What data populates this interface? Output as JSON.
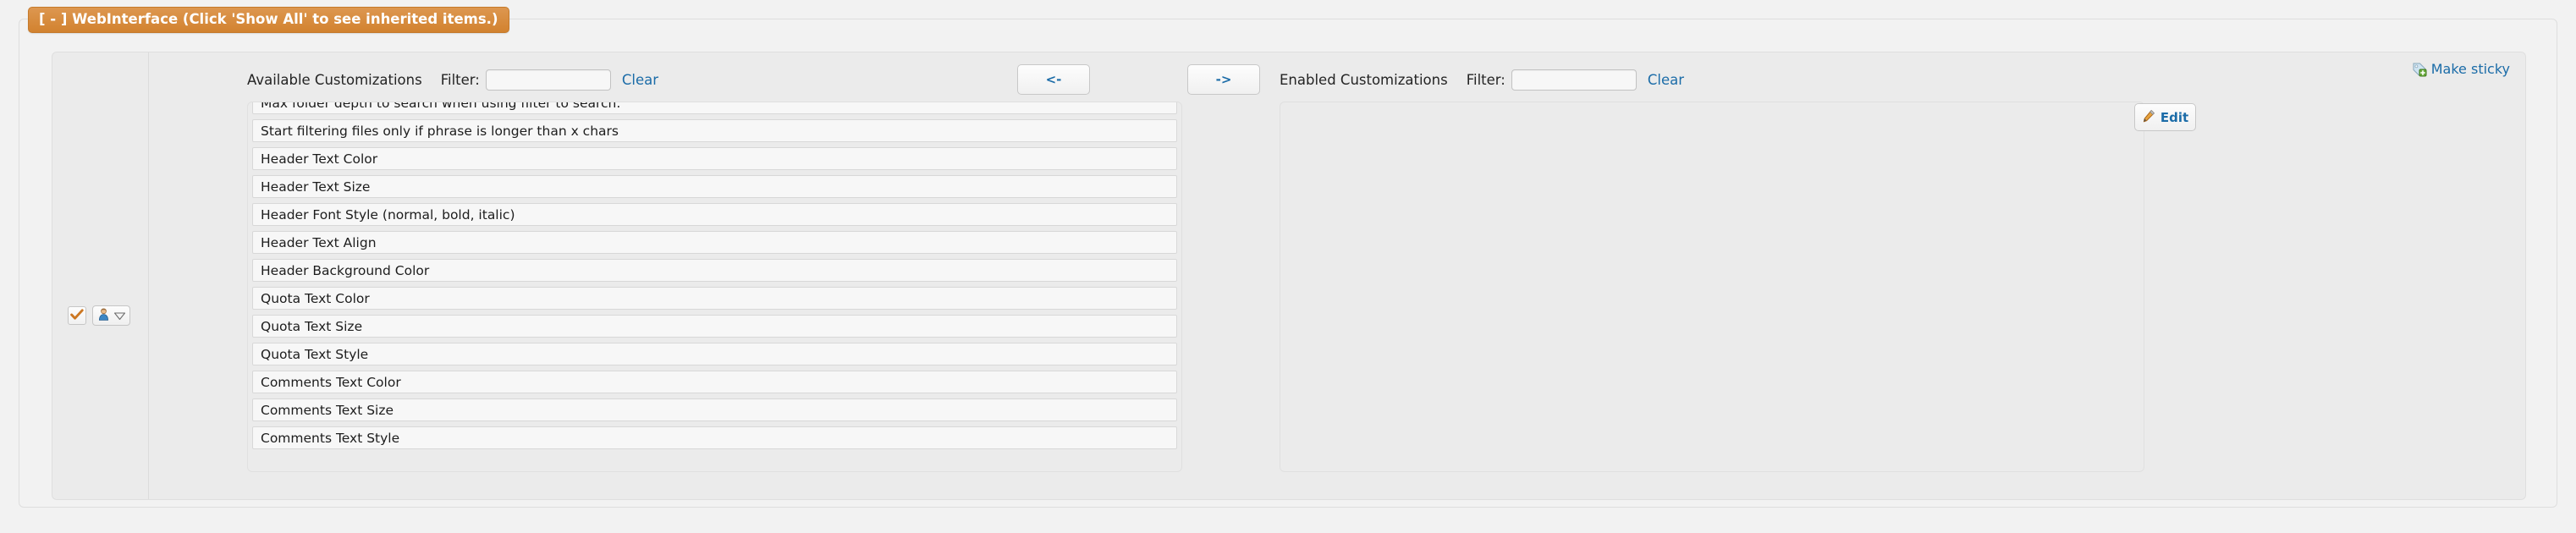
{
  "window": {
    "background_color": "#f2f2f2"
  },
  "tab": {
    "label": "[ - ] WebInterface (Click 'Show All' to see inherited items.)",
    "accent_color": "#d2822f",
    "text_color": "#ffffff"
  },
  "make_sticky": {
    "icon": "tag-add-icon",
    "label": "Make sticky",
    "link_color": "#1b6ca8"
  },
  "gutter": {
    "checkbox": {
      "icon": "checkmark-icon",
      "checked": true,
      "check_color": "#cc7722"
    },
    "user_selector": {
      "icon": "user-icon",
      "dropdown_icon": "triangle-down-icon"
    }
  },
  "available": {
    "title": "Available Customizations",
    "filter_label": "Filter:",
    "filter_value": "",
    "filter_placeholder": "",
    "clear_label": "Clear",
    "items": [
      "Max folder depth to search when using filter to search.",
      "Start filtering files only if phrase is longer than x chars",
      "Header Text Color",
      "Header Text Size",
      "Header Font Style (normal, bold, italic)",
      "Header Text Align",
      "Header Background Color",
      "Quota Text Color",
      "Quota Text Size",
      "Quota Text Style",
      "Comments Text Color",
      "Comments Text Size",
      "Comments Text Style"
    ]
  },
  "transfer": {
    "move_left_label": "<-",
    "move_right_label": "->",
    "label_color": "#1b6ca8"
  },
  "enabled": {
    "title": "Enabled Customizations",
    "filter_label": "Filter:",
    "filter_value": "",
    "filter_placeholder": "",
    "clear_label": "Clear",
    "items": []
  },
  "edit": {
    "icon": "pencil-icon",
    "label": "Edit",
    "icon_color": "#d2822f"
  }
}
